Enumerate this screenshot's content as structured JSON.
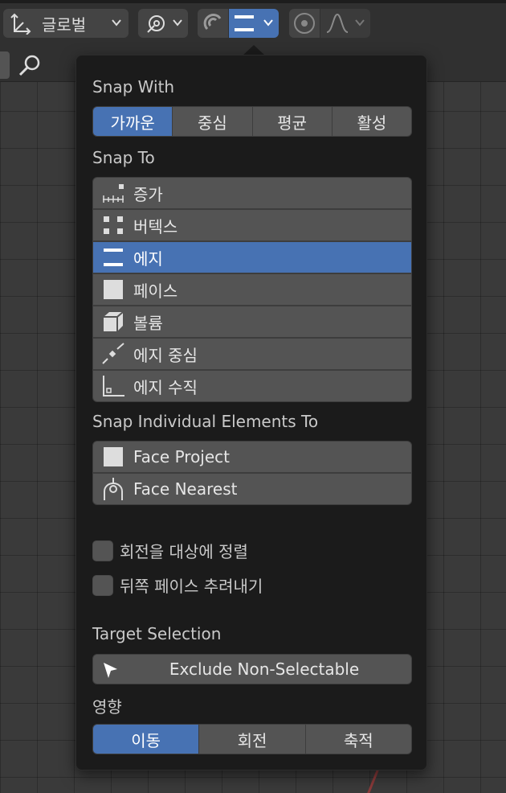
{
  "header": {
    "orientation_label": "글로벌"
  },
  "popup": {
    "snap_with": {
      "label": "Snap With",
      "options": [
        "가까운",
        "중심",
        "평균",
        "활성"
      ],
      "active_index": 0
    },
    "snap_to": {
      "label": "Snap To",
      "items": [
        {
          "label": "증가",
          "icon": "increment-icon"
        },
        {
          "label": "버텍스",
          "icon": "vertex-icon"
        },
        {
          "label": "에지",
          "icon": "edge-icon"
        },
        {
          "label": "페이스",
          "icon": "face-icon"
        },
        {
          "label": "볼륨",
          "icon": "volume-icon"
        },
        {
          "label": "에지 중심",
          "icon": "edge-center-icon"
        },
        {
          "label": "에지 수직",
          "icon": "edge-perpendicular-icon"
        }
      ],
      "active_index": 2
    },
    "snap_individual": {
      "label": "Snap Individual Elements To",
      "items": [
        {
          "label": "Face Project",
          "icon": "face-project-icon"
        },
        {
          "label": "Face Nearest",
          "icon": "face-nearest-icon"
        }
      ]
    },
    "checkboxes": [
      {
        "label": "회전을 대상에 정렬",
        "checked": false
      },
      {
        "label": "뒤쪽 페이스 추려내기",
        "checked": false
      }
    ],
    "target_selection": {
      "label": "Target Selection",
      "value": "Exclude Non-Selectable"
    },
    "affect": {
      "label": "영향",
      "options": [
        "이동",
        "회전",
        "축적"
      ],
      "active_index": 0
    }
  },
  "colors": {
    "accent": "#4772b3",
    "button": "#545454",
    "panel": "#1b1b1b"
  }
}
